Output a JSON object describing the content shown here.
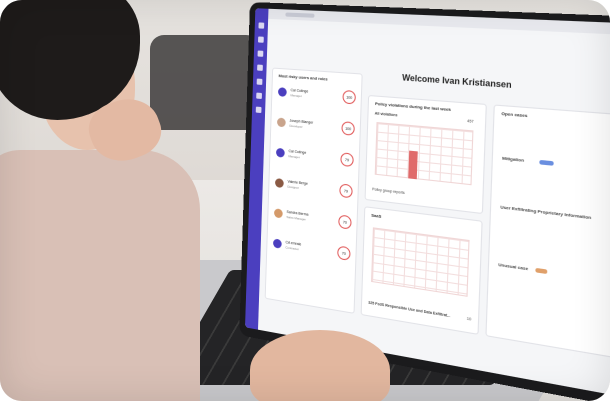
{
  "app": {
    "welcome_title": "Welcome Ivan Kristiansen"
  },
  "panels": {
    "users_title": "Most risky users and roles",
    "policy_title": "Policy violations during the last week",
    "open_cases_title": "Open cases",
    "all_violations_label": "All violations",
    "all_violations_count": "457",
    "saas_title": "SaaS",
    "saas_footer": "325 FedS Responsible Use and Data Exfiltrat...",
    "saas_footer_count": "10",
    "policy_footer": "Policy group reports"
  },
  "users": [
    {
      "name": "Cai Cutinge",
      "role": "Manager",
      "score": "100"
    },
    {
      "name": "Joseph Blanger",
      "role": "Developer",
      "score": "100"
    },
    {
      "name": "Cai Cutinge",
      "role": "Manager",
      "score": "79"
    },
    {
      "name": "Valerie Berge",
      "role": "Designer",
      "score": "79"
    },
    {
      "name": "Sandra Berma",
      "role": "Sales Manager",
      "score": "70"
    },
    {
      "name": "CA emrale",
      "role": "Contractor",
      "score": "70"
    }
  ],
  "cases": [
    {
      "title": "Mitigation",
      "tag_color": "#6a8fe0"
    },
    {
      "title": "User Exfiltrating Proprietary Information",
      "tag_color": "#6a8fe0"
    },
    {
      "title": "Unusual case",
      "tag_color": "#e0a06a"
    }
  ],
  "colors": {
    "accent": "#4b3fbf",
    "risk": "#e05656",
    "bar": "#e06a6a"
  }
}
